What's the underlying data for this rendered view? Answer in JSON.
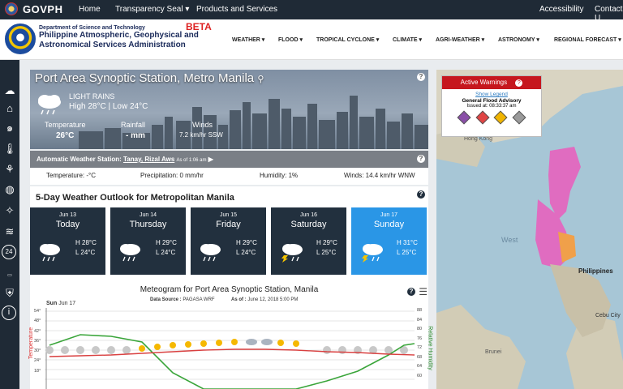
{
  "topbar": {
    "brand": "GOVPH",
    "nav": [
      "Home",
      "Transparency Seal ▾",
      "Products and Services"
    ],
    "right": [
      "Accessibility",
      "Contact U"
    ]
  },
  "header": {
    "dept": "Department of Science and Technology",
    "agency_line1": "Philippine Atmospheric, Geophysical and",
    "agency_line2": "Astronomical Services Administration",
    "beta": "BETA",
    "menu": [
      "WEATHER ▾",
      "FLOOD ▾",
      "TROPICAL CYCLONE ▾",
      "CLIMATE ▾",
      "AGRI-WEATHER ▾",
      "ASTRONOMY ▾",
      "REGIONAL FORECAST ▾"
    ]
  },
  "station": {
    "title": "Port Area Synoptic Station, Metro Manila",
    "condition": "LIGHT RAINS",
    "highlow": "High 28°C | Low 24°C",
    "temp_label": "Temperature",
    "temp_value": "26°C",
    "rain_label": "Rainfall",
    "rain_value": "- mm",
    "wind_label": "Winds",
    "wind_value": "7.2 km/hr SSW"
  },
  "aws": {
    "title": "Automatic Weather Station:",
    "station": "Tanay, Rizal Aws",
    "asof": "As of 1:06 am",
    "temperature": "Temperature: -°C",
    "precipitation": "Precipitation: 0 mm/hr",
    "humidity": "Humidity: 1%",
    "winds": "Winds: 14.4 km/hr WNW"
  },
  "outlook": {
    "heading": "5-Day Weather Outlook for Metropolitan Manila",
    "days": [
      {
        "date": "Jun 13",
        "name": "Today",
        "high": "H 28°C",
        "low": "L 24°C",
        "icon": "rain-cloud-icon"
      },
      {
        "date": "Jun 14",
        "name": "Thursday",
        "high": "H 29°C",
        "low": "L 24°C",
        "icon": "rain-cloud-icon"
      },
      {
        "date": "Jun 15",
        "name": "Friday",
        "high": "H 29°C",
        "low": "L 24°C",
        "icon": "rain-cloud-icon"
      },
      {
        "date": "Jun 16",
        "name": "Saturday",
        "high": "H 29°C",
        "low": "L 25°C",
        "icon": "thunderstorm-icon"
      },
      {
        "date": "Jun 17",
        "name": "Sunday",
        "high": "H 31°C",
        "low": "L 25°C",
        "icon": "thunderstorm-icon"
      }
    ]
  },
  "meteogram": {
    "title": "Meteogram for Port Area Synoptic Station, Manila",
    "source_label": "Data Source :",
    "source": "PAGASA WRF",
    "asof_label": "As of :",
    "asof": "June 12, 2018 5:00 PM",
    "day_label": "Sun",
    "day_date": "Jun 17",
    "left_axis": "Temperature",
    "right_axis": "Relative Humidity",
    "left_ticks": [
      "54°",
      "48°",
      "42°",
      "36°",
      "30°",
      "24°",
      "18°"
    ],
    "right_ticks": [
      "88",
      "84",
      "80",
      "76",
      "72",
      "68",
      "64",
      "60"
    ]
  },
  "warnings": {
    "title": "Active Warnings",
    "legend": "Show Legend",
    "advisory": "General Flood Advisory",
    "issued": "Issued at: 08:33:37 am"
  },
  "map": {
    "labels": [
      "Hong Kong",
      "Philippines",
      "West",
      "Cebu City",
      "Brunei"
    ],
    "colors": {
      "warning_red": "#c6171e",
      "accent_blue": "#2a96e6",
      "dark": "#1f2a36"
    }
  }
}
